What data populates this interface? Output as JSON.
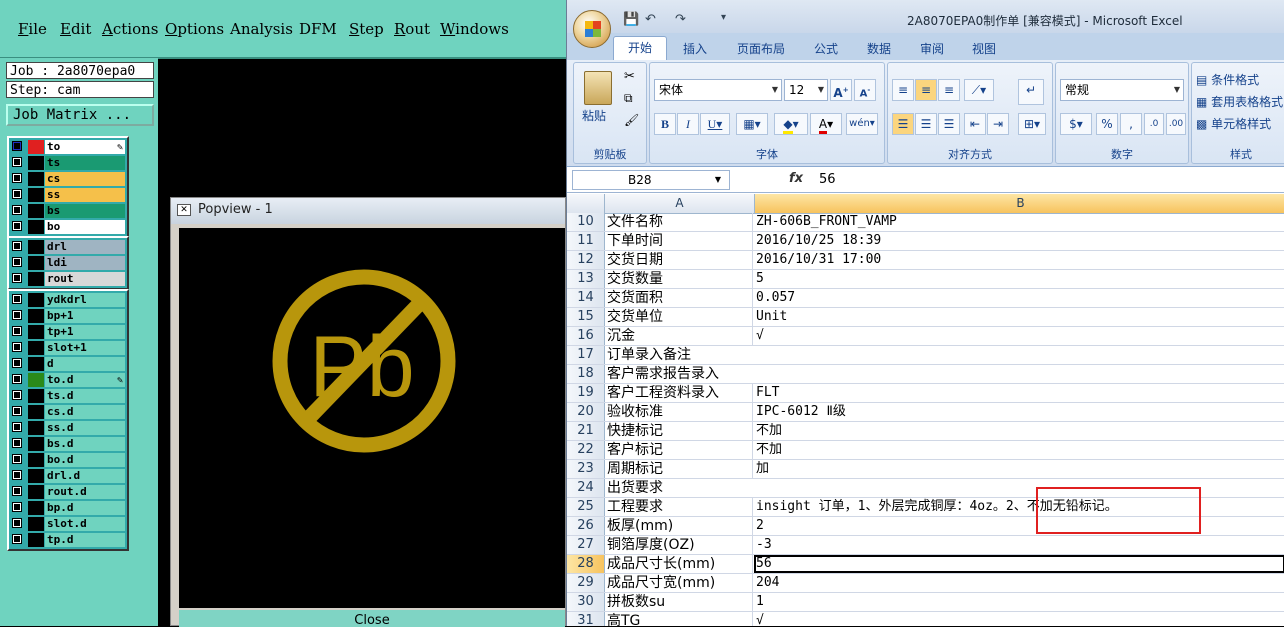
{
  "cam": {
    "menu": [
      "File",
      "Edit",
      "Actions",
      "Options",
      "Analysis",
      "DFM",
      "Step",
      "Rout",
      "Windows"
    ],
    "job_label": "Job : 2a8070epa0",
    "step_label": "Step: cam",
    "job_matrix_button": "Job Matrix ...",
    "layers_board": [
      {
        "name": "to",
        "color": "#ffffff"
      },
      {
        "name": "ts",
        "color": "#1a9a72"
      },
      {
        "name": "cs",
        "color": "#f5c04a"
      },
      {
        "name": "ss",
        "color": "#f5c04a"
      },
      {
        "name": "bs",
        "color": "#1a9a72"
      },
      {
        "name": "bo",
        "color": "#ffffff"
      }
    ],
    "layers_drill": [
      {
        "name": "drl",
        "color": "#9fb4c2"
      },
      {
        "name": "ldi",
        "color": "#9fb4c2"
      },
      {
        "name": "rout",
        "color": "#d8d8d8"
      }
    ],
    "layers_misc": [
      {
        "name": "ydkdrl",
        "color": "#6fd3bf"
      },
      {
        "name": "bp+1",
        "color": "#6fd3bf"
      },
      {
        "name": "tp+1",
        "color": "#6fd3bf"
      },
      {
        "name": "slot+1",
        "color": "#6fd3bf"
      },
      {
        "name": "d",
        "color": "#6fd3bf"
      },
      {
        "name": "to.d",
        "color": "#6fd3bf"
      },
      {
        "name": "ts.d",
        "color": "#6fd3bf"
      },
      {
        "name": "cs.d",
        "color": "#6fd3bf"
      },
      {
        "name": "ss.d",
        "color": "#6fd3bf"
      },
      {
        "name": "bs.d",
        "color": "#6fd3bf"
      },
      {
        "name": "bo.d",
        "color": "#6fd3bf"
      },
      {
        "name": "drl.d",
        "color": "#6fd3bf"
      },
      {
        "name": "rout.d",
        "color": "#6fd3bf"
      },
      {
        "name": "bp.d",
        "color": "#6fd3bf"
      },
      {
        "name": "slot.d",
        "color": "#6fd3bf"
      },
      {
        "name": "tp.d",
        "color": "#6fd3bf"
      }
    ],
    "popview": {
      "title": "Popview - 1",
      "close_label": "Close",
      "symbol_text": "Pb",
      "symbol_color": "#b8960c"
    }
  },
  "excel": {
    "window_title": "2A8070EPA0制作单  [兼容模式] - Microsoft Excel",
    "tabs": [
      "开始",
      "插入",
      "页面布局",
      "公式",
      "数据",
      "审阅",
      "视图"
    ],
    "ribbon": {
      "paste": "粘贴",
      "clipboard": "剪贴板",
      "font_name": "宋体",
      "font_size": "12",
      "font_group": "字体",
      "align_group": "对齐方式",
      "number_format": "常规",
      "number_group": "数字",
      "style_cond": "条件格式",
      "style_table": "套用表格格式",
      "style_cell": "单元格样式",
      "style_group": "样式"
    },
    "name_box": "B28",
    "formula": "56",
    "col_a": "A",
    "col_b": "B",
    "rows": [
      {
        "n": "10",
        "a": "文件名称",
        "b": "ZH-606B_FRONT_VAMP"
      },
      {
        "n": "11",
        "a": "下单时间",
        "b": "2016/10/25 18:39"
      },
      {
        "n": "12",
        "a": "交货日期",
        "b": "2016/10/31 17:00"
      },
      {
        "n": "13",
        "a": "交货数量",
        "b": "5"
      },
      {
        "n": "14",
        "a": "交货面积",
        "b": "0.057"
      },
      {
        "n": "15",
        "a": "交货单位",
        "b": "Unit"
      },
      {
        "n": "16",
        "a": "沉金",
        "b": "√"
      },
      {
        "n": "17",
        "a": "订单录入备注",
        "b": ""
      },
      {
        "n": "18",
        "a": "客户需求报告录入",
        "b": ""
      },
      {
        "n": "19",
        "a": "客户工程资料录入",
        "b": "FLT"
      },
      {
        "n": "20",
        "a": "验收标准",
        "b": "IPC-6012 Ⅱ级"
      },
      {
        "n": "21",
        "a": "快捷标记",
        "b": "不加"
      },
      {
        "n": "22",
        "a": "客户标记",
        "b": "不加"
      },
      {
        "n": "23",
        "a": "周期标记",
        "b": "加"
      },
      {
        "n": "24",
        "a": "出货要求",
        "b": ""
      },
      {
        "n": "25",
        "a": "工程要求",
        "b": "insight 订单，1、外层完成铜厚：4oz。2、不加无铅标记。"
      },
      {
        "n": "26",
        "a": "板厚(mm)",
        "b": "2"
      },
      {
        "n": "27",
        "a": "铜箔厚度(OZ)",
        "b": "-3"
      },
      {
        "n": "28",
        "a": "成品尺寸长(mm)",
        "b": "56"
      },
      {
        "n": "29",
        "a": "成品尺寸宽(mm)",
        "b": "204"
      },
      {
        "n": "30",
        "a": "拼板数su",
        "b": "1"
      },
      {
        "n": "31",
        "a": "高TG",
        "b": "√"
      }
    ]
  }
}
